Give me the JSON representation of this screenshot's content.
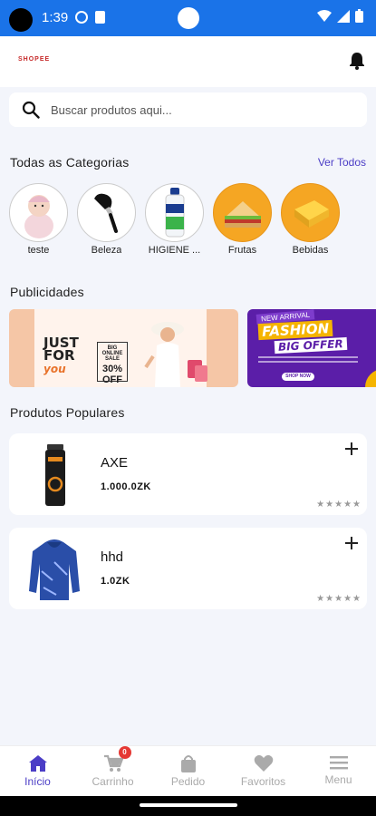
{
  "status_bar": {
    "time": "1:39"
  },
  "header": {
    "logo": "SHOPEE"
  },
  "search": {
    "placeholder": "Buscar produtos aqui..."
  },
  "categories_section": {
    "title": "Todas as Categorias",
    "see_all": "Ver Todos",
    "items": [
      {
        "label": "teste",
        "icon": "baby-photo"
      },
      {
        "label": "Beleza",
        "icon": "makeup-brush"
      },
      {
        "label": "HIGIENE ...",
        "icon": "shampoo-bottle"
      },
      {
        "label": "Frutas",
        "icon": "sandwich"
      },
      {
        "label": "Bebidas",
        "icon": "orange-box"
      }
    ]
  },
  "ads_section": {
    "title": "Publicidades",
    "ads": [
      {
        "headline": "JUST FOR",
        "script": "you",
        "offer_top": "BIG ONLINE SALE",
        "offer_value": "30% OFF"
      },
      {
        "tag": "NEW ARRIVAL",
        "headline": "FASHION",
        "subheadline": "BIG OFFER",
        "button": "SHOP NOW"
      }
    ]
  },
  "products_section": {
    "title": "Produtos Populares",
    "items": [
      {
        "name": "AXE",
        "price": "1.000.0ZK",
        "rating": "★★★★★",
        "image": "deodorant-can"
      },
      {
        "name": "hhd",
        "price": "1.0ZK",
        "rating": "★★★★★",
        "image": "blue-hoodie"
      }
    ]
  },
  "bottom_nav": {
    "items": [
      {
        "label": "Início",
        "icon": "home-icon",
        "active": true
      },
      {
        "label": "Carrinho",
        "icon": "cart-icon",
        "badge": "0"
      },
      {
        "label": "Pedido",
        "icon": "bag-icon"
      },
      {
        "label": "Favoritos",
        "icon": "heart-icon"
      },
      {
        "label": "Menu",
        "icon": "menu-icon"
      }
    ]
  },
  "colors": {
    "accent": "#4b3dc6",
    "status_bar": "#1a73e8",
    "badge": "#e53935",
    "background": "#f3f5fb"
  }
}
